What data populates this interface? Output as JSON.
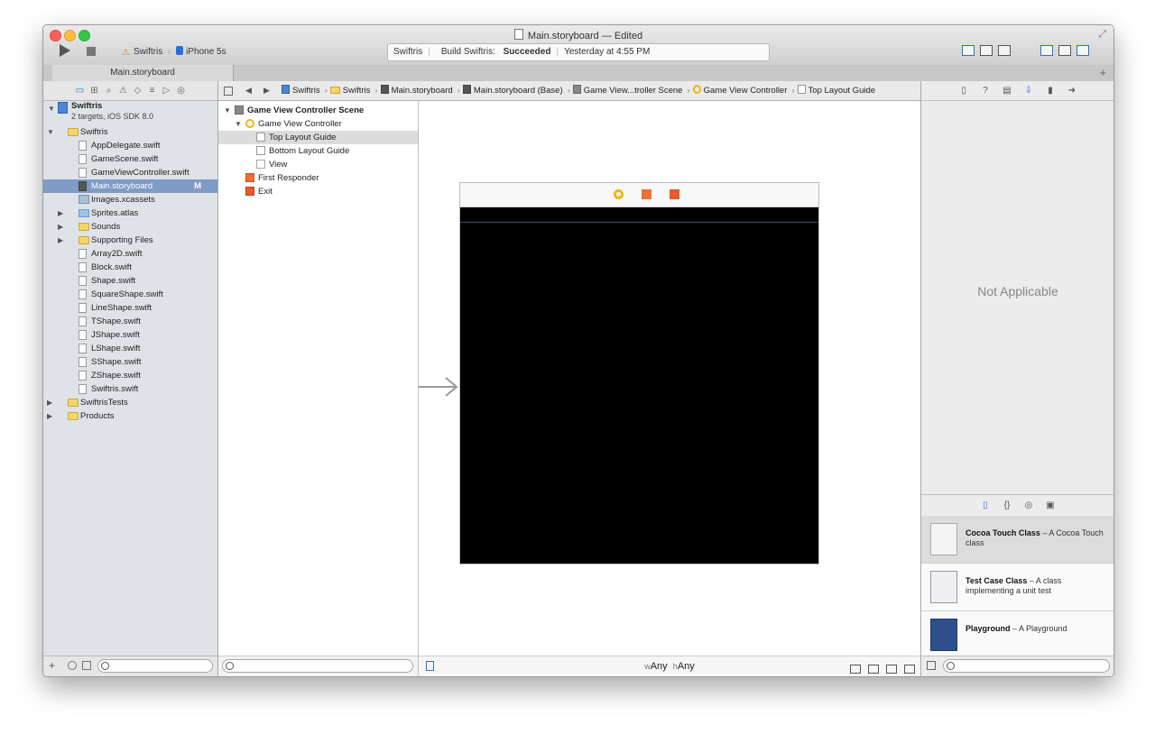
{
  "window": {
    "title": "Main.storyboard — Edited"
  },
  "toolbar": {
    "scheme": "Swiftris",
    "device": "iPhone 5s",
    "activity": {
      "project": "Swiftris",
      "build_prefix": "Build Swiftris:",
      "build_status": "Succeeded",
      "time": "Yesterday at 4:55 PM"
    }
  },
  "tabs": [
    {
      "label": "Main.storyboard"
    }
  ],
  "navigator": {
    "project": {
      "name": "Swiftris",
      "subtitle": "2 targets, iOS SDK 8.0"
    },
    "items": [
      {
        "label": "Swiftris",
        "kind": "folder",
        "level": 1,
        "disclosure": "open"
      },
      {
        "label": "AppDelegate.swift",
        "kind": "swift",
        "level": 2
      },
      {
        "label": "GameScene.swift",
        "kind": "swift",
        "level": 2
      },
      {
        "label": "GameViewController.swift",
        "kind": "swift",
        "level": 2
      },
      {
        "label": "Main.storyboard",
        "kind": "storyboard",
        "level": 2,
        "selected": true,
        "badge": "M"
      },
      {
        "label": "Images.xcassets",
        "kind": "xcassets",
        "level": 2
      },
      {
        "label": "Sprites.atlas",
        "kind": "atlas",
        "level": 2,
        "disclosure": "closed"
      },
      {
        "label": "Sounds",
        "kind": "folder",
        "level": 2,
        "disclosure": "closed"
      },
      {
        "label": "Supporting Files",
        "kind": "folder",
        "level": 2,
        "disclosure": "closed"
      },
      {
        "label": "Array2D.swift",
        "kind": "swift",
        "level": 2
      },
      {
        "label": "Block.swift",
        "kind": "swift",
        "level": 2
      },
      {
        "label": "Shape.swift",
        "kind": "swift",
        "level": 2
      },
      {
        "label": "SquareShape.swift",
        "kind": "swift",
        "level": 2
      },
      {
        "label": "LineShape.swift",
        "kind": "swift",
        "level": 2
      },
      {
        "label": "TShape.swift",
        "kind": "swift",
        "level": 2
      },
      {
        "label": "JShape.swift",
        "kind": "swift",
        "level": 2
      },
      {
        "label": "LShape.swift",
        "kind": "swift",
        "level": 2
      },
      {
        "label": "SShape.swift",
        "kind": "swift",
        "level": 2
      },
      {
        "label": "ZShape.swift",
        "kind": "swift",
        "level": 2
      },
      {
        "label": "Swiftris.swift",
        "kind": "swift",
        "level": 2
      },
      {
        "label": "SwiftrisTests",
        "kind": "folder",
        "level": 1,
        "disclosure": "closed"
      },
      {
        "label": "Products",
        "kind": "folder",
        "level": 1,
        "disclosure": "closed"
      }
    ]
  },
  "jumpbar": [
    {
      "label": "Swiftris",
      "icon": "project-icon"
    },
    {
      "label": "Swiftris",
      "icon": "folder-icon"
    },
    {
      "label": "Main.storyboard",
      "icon": "storyboard-icon"
    },
    {
      "label": "Main.storyboard (Base)",
      "icon": "storyboard-icon"
    },
    {
      "label": "Game View...troller Scene",
      "icon": "scene-icon"
    },
    {
      "label": "Game View Controller",
      "icon": "view-controller-icon"
    },
    {
      "label": "Top Layout Guide",
      "icon": "layout-guide-icon"
    }
  ],
  "outline": {
    "items": [
      {
        "label": "Game View Controller Scene",
        "kind": "scene",
        "level": 0,
        "disclosure": "open",
        "bold": true
      },
      {
        "label": "Game View Controller",
        "kind": "vc",
        "level": 1,
        "disclosure": "open"
      },
      {
        "label": "Top Layout Guide",
        "kind": "guide",
        "level": 2,
        "highlight": true
      },
      {
        "label": "Bottom Layout Guide",
        "kind": "guide",
        "level": 2
      },
      {
        "label": "View",
        "kind": "view",
        "level": 2
      },
      {
        "label": "First Responder",
        "kind": "responder",
        "level": 1
      },
      {
        "label": "Exit",
        "kind": "exit",
        "level": 1
      }
    ]
  },
  "canvas": {
    "size_class_w_prefix": "w",
    "size_class_w": "Any",
    "size_class_h_prefix": "h",
    "size_class_h": "Any",
    "view_background": "#000000"
  },
  "inspector": {
    "message": "Not Applicable"
  },
  "library": {
    "items": [
      {
        "title": "Cocoa Touch Class",
        "desc": " – A Cocoa Touch class",
        "icon": "cocoa-touch-class-icon",
        "selected": true
      },
      {
        "title": "Test Case Class",
        "desc": " – A class implementing a unit test",
        "icon": "test-case-class-icon"
      },
      {
        "title": "Playground",
        "desc": " – A Playground",
        "icon": "playground-icon"
      }
    ]
  },
  "colors": {
    "accent": "#2a6fd6",
    "selection": "#7f9bc6",
    "view_controller": "#f1b60f",
    "first_responder": "#ef6f32"
  }
}
